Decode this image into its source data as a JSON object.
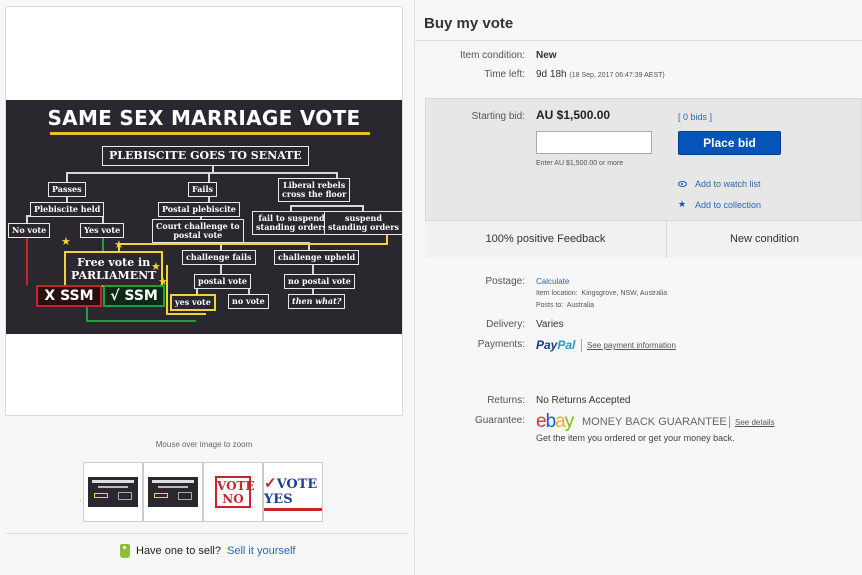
{
  "item": {
    "title": "Buy my vote",
    "condition_label": "Item condition:",
    "condition_value": "New",
    "time_left_label": "Time left:",
    "time_left_value": "9d 18h",
    "time_left_detail": "(18 Sep, 2017   06:47:39 AEST)"
  },
  "bid": {
    "starting_label": "Starting bid:",
    "price": "AU $1,500.00",
    "input_value": "",
    "hint": "Enter AU $1,500.00 or more",
    "bids_link": "[ 0 bids ]",
    "place_bid_label": "Place bid",
    "watch_label": "Add to watch list",
    "collection_label": "Add to collection",
    "feedback": "100% positive Feedback",
    "condition_badge": "New condition"
  },
  "shipping": {
    "postage_label": "Postage:",
    "postage_value": "Calculate",
    "location_label": "Item location:",
    "location_value": "Kingsgrove, NSW, Australia",
    "posts_to_label": "Posts to:",
    "posts_to_value": "Australia",
    "delivery_label": "Delivery:",
    "delivery_value": "Varies",
    "payments_label": "Payments:",
    "paypal_part1": "Pay",
    "paypal_part2": "Pal",
    "payment_info_link": "See payment information",
    "returns_label": "Returns:",
    "returns_value": "No Returns Accepted",
    "guarantee_label": "Guarantee:",
    "ebay_e": "e",
    "ebay_b": "b",
    "ebay_a": "a",
    "ebay_y": "y",
    "mbg_text": "MONEY BACK GUARANTEE",
    "see_details": "See details",
    "guarantee_desc": "Get the item you ordered or get your money back."
  },
  "gallery": {
    "zoom_hint": "Mouse over image to zoom",
    "thumb3_text_line1": "VOTE",
    "thumb3_text_line2": "NO",
    "thumb4_check": "✓",
    "thumb4_text": "VOTE YES",
    "sell_prompt": "Have one to sell?",
    "sell_link": "Sell it yourself"
  },
  "flowchart": {
    "title": "SAME SEX MARRIAGE VOTE",
    "senate": "PLEBISCITE GOES TO SENATE",
    "passes": "Passes",
    "fails": "Fails",
    "liberal_rebels_1": "Liberal rebels",
    "liberal_rebels_2": "cross the floor",
    "plebiscite_held": "Plebiscite held",
    "postal_plebiscite": "Postal plebiscite",
    "fail_suspend_1": "fail to suspend",
    "fail_suspend_2": "standing orders",
    "suspend_1": "suspend",
    "suspend_2": "standing orders",
    "no_vote": "No vote",
    "yes_vote": "Yes vote",
    "court_challenge_1": "Court challenge to",
    "court_challenge_2": "postal vote",
    "free_vote_1": "Free vote in",
    "free_vote_2": "PARLIAMENT",
    "challenge_fails": "challenge fails",
    "challenge_upheld": "challenge upheld",
    "postal_vote": "postal vote",
    "no_postal_vote": "no postal vote",
    "x_ssm": "X SSM",
    "check_ssm": "√ SSM",
    "yes_vote_small": "yes vote",
    "no_vote_small": "no vote",
    "then_what": "then what?"
  }
}
